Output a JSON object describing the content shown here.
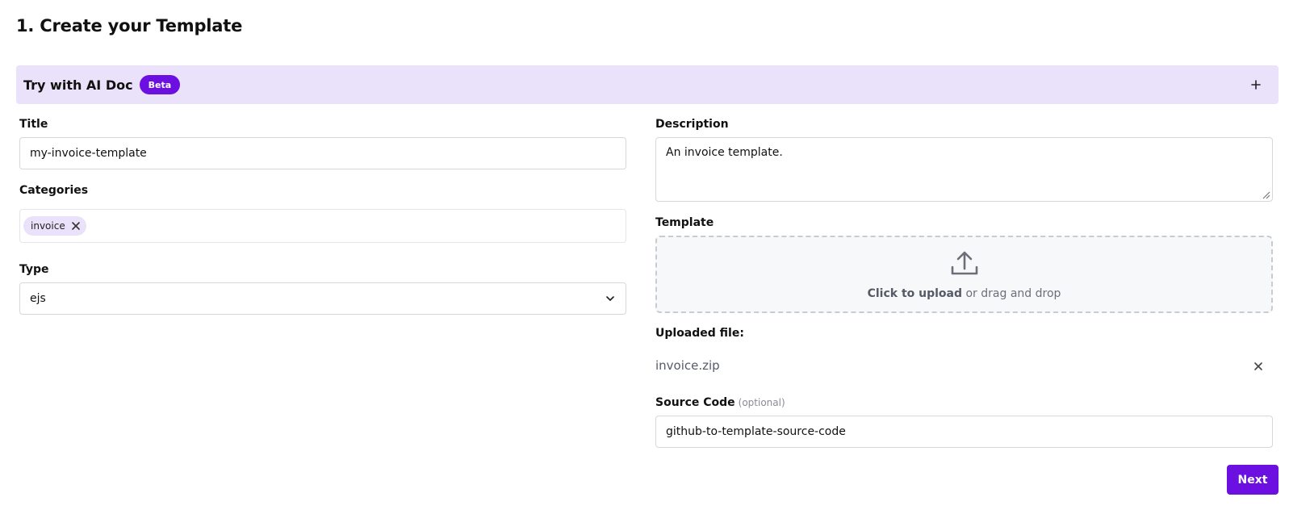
{
  "page": {
    "title": "1. Create your Template"
  },
  "ai_doc": {
    "label": "Try with AI Doc",
    "badge": "Beta",
    "toggle_icon": "plus-icon"
  },
  "form": {
    "title": {
      "label": "Title",
      "value": "my-invoice-template"
    },
    "categories": {
      "label": "Categories",
      "chips": [
        {
          "label": "invoice",
          "remove_icon": "close-icon"
        }
      ]
    },
    "type": {
      "label": "Type",
      "selected": "ejs",
      "icon": "chevron-down-icon"
    },
    "description": {
      "label": "Description",
      "value": "An invoice template."
    },
    "template": {
      "label": "Template",
      "dropzone": {
        "icon": "upload-icon",
        "action_text": "Click to upload",
        "rest_text": "or drag and drop"
      }
    },
    "uploaded": {
      "label": "Uploaded file:",
      "file_name": "invoice.zip",
      "remove_icon": "close-icon"
    },
    "source_code": {
      "label": "Source Code",
      "hint": "(optional)",
      "value": "github-to-template-source-code"
    }
  },
  "actions": {
    "next_label": "Next"
  },
  "colors": {
    "accent": "#6b10e0",
    "accent_soft": "#e9e2fa",
    "border": "#d6d6dc",
    "dropzone_bg": "#f7f8fa"
  }
}
